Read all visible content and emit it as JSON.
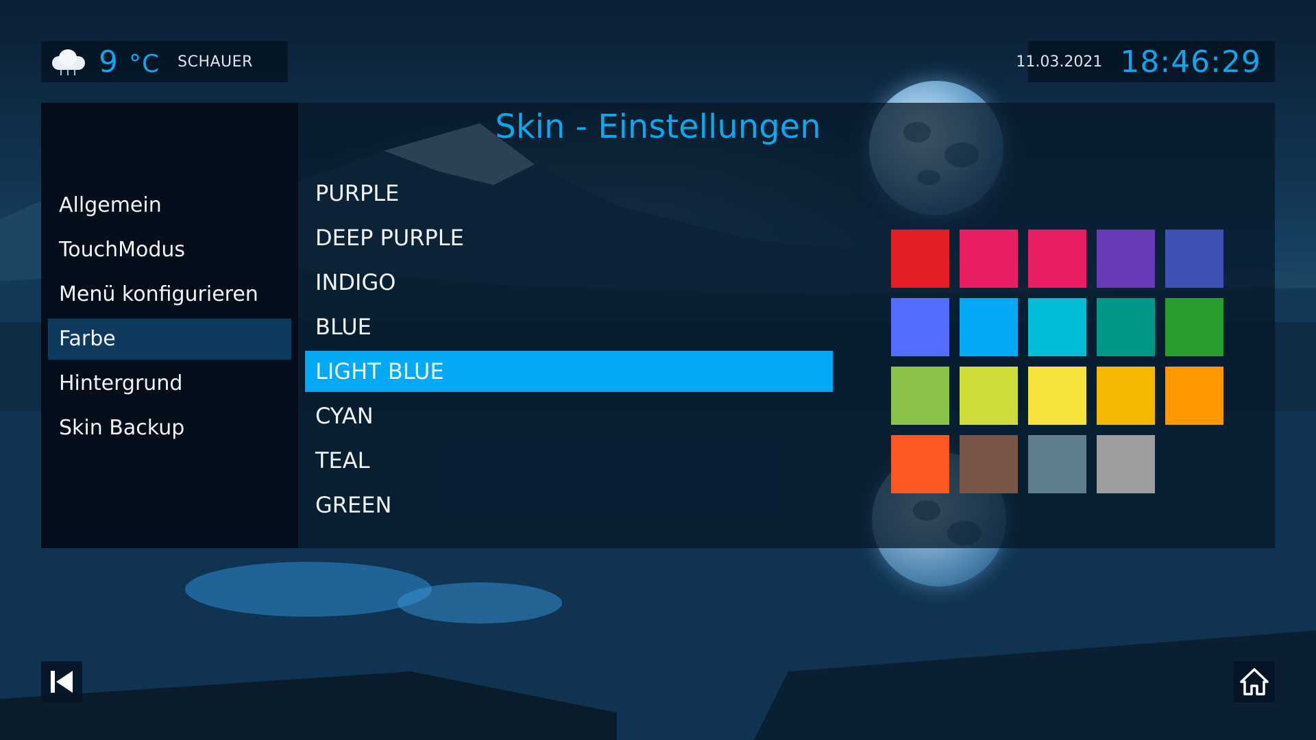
{
  "weather": {
    "icon": "cloud-rain-icon",
    "temperature": "9",
    "unit": "°C",
    "condition": "SCHAUER"
  },
  "clock": {
    "date": "11.03.2021",
    "time": "18:46:29"
  },
  "page": {
    "title": "Skin - Einstellungen"
  },
  "sidebar": {
    "items": [
      {
        "label": "Allgemein"
      },
      {
        "label": "TouchModus"
      },
      {
        "label": "Menü konfigurieren"
      },
      {
        "label": "Farbe",
        "active": true
      },
      {
        "label": "Hintergrund"
      },
      {
        "label": "Skin Backup"
      }
    ]
  },
  "color_list": {
    "items": [
      {
        "label": "PURPLE"
      },
      {
        "label": "DEEP PURPLE"
      },
      {
        "label": "INDIGO"
      },
      {
        "label": "BLUE"
      },
      {
        "label": "LIGHT BLUE",
        "selected": true
      },
      {
        "label": "CYAN"
      },
      {
        "label": "TEAL"
      },
      {
        "label": "GREEN"
      }
    ]
  },
  "palette": [
    "#e31e24",
    "#e91e63",
    "#e91e63",
    "#673ab7",
    "#3f51b5",
    "#536dfe",
    "#03a9f4",
    "#00bcd4",
    "#009688",
    "#2a9d2f",
    "#8bc34a",
    "#cddc39",
    "#f5e23b",
    "#f5b800",
    "#ff9800",
    "#ff5722",
    "#795548",
    "#607d8b",
    "#9e9e9e"
  ],
  "nav": {
    "back_icon": "skip-back-icon",
    "home_icon": "home-icon"
  },
  "colors": {
    "accent": "#10a6ec",
    "selection": "#03a9f4",
    "sidebar_active": "#0d3a5e"
  }
}
